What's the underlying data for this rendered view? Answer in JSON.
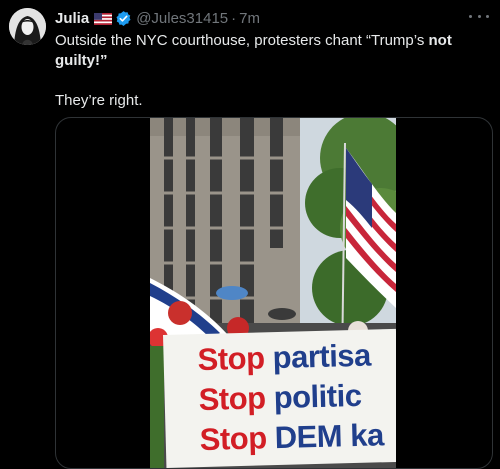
{
  "author": {
    "name": "Julia",
    "handle": "@Jules31415",
    "separator": "·",
    "time": "7m"
  },
  "tweet": {
    "text_before_bold": "Outside the NYC courthouse, protesters chant “Trump’s ",
    "text_bold": "not guilty",
    "text_after_bold": "!”",
    "second_paragraph": "They’re right."
  },
  "media": {
    "banner_lines": [
      {
        "red": "Stop ",
        "blue": "partisa"
      },
      {
        "red": "Stop ",
        "blue": "politic"
      },
      {
        "red": "Stop ",
        "blue": "DEM ka"
      }
    ]
  },
  "colors": {
    "background": "#000000",
    "text": "#e7e9ea",
    "muted": "#71767b",
    "verified": "#1d9bf0",
    "border": "#2f3336",
    "banner_red": "#d21e25",
    "banner_blue": "#203f8c"
  },
  "icons": [
    "avatar",
    "us-flag-icon",
    "verified-badge-icon",
    "more-options-icon"
  ]
}
